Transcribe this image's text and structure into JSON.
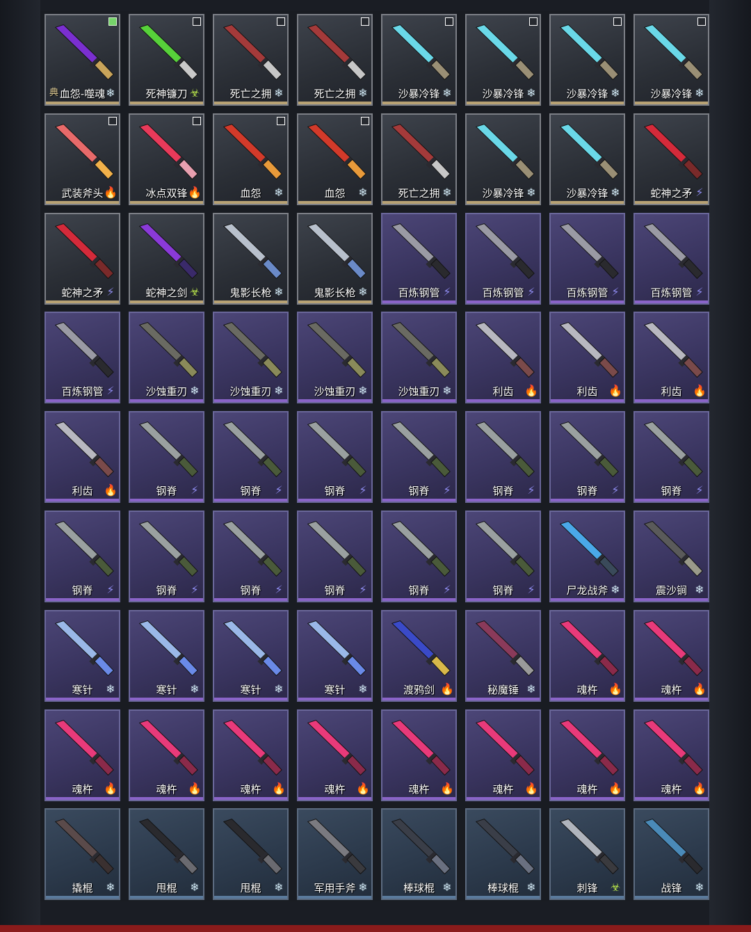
{
  "element_icons": {
    "snowflake": {
      "glyph": "❄",
      "color": "#cfe6f2"
    },
    "lightning": {
      "glyph": "⚡",
      "color": "#8f8cf0"
    },
    "fire": {
      "glyph": "🔥",
      "color": "#f0a53a"
    },
    "toxic": {
      "glyph": "☣",
      "color": "#b7e34a"
    }
  },
  "rarity_colors": {
    "gold": "#b8a274",
    "purple": "#8a64c8",
    "blue": "#5a7a9c"
  },
  "rows": [
    [
      {
        "name": "血怨-噬魂",
        "rarity": "gold",
        "element": "snowflake",
        "check": "on",
        "tag": "典",
        "icon": "purple-orb-amulet-icon",
        "c1": "#7a2fd0",
        "c2": "#c9a45a"
      },
      {
        "name": "死神镰刀",
        "rarity": "gold",
        "element": "toxic",
        "check": "off",
        "icon": "scythe-icon",
        "c1": "#57d13a",
        "c2": "#c9c9c9"
      },
      {
        "name": "死亡之拥",
        "rarity": "gold",
        "element": "snowflake",
        "check": "off",
        "icon": "rifle-icon",
        "c1": "#a43a3a",
        "c2": "#c7c7c7"
      },
      {
        "name": "死亡之拥",
        "rarity": "gold",
        "element": "snowflake",
        "check": "off",
        "icon": "rifle-icon",
        "c1": "#a43a3a",
        "c2": "#c7c7c7"
      },
      {
        "name": "沙暴冷锋",
        "rarity": "gold",
        "element": "snowflake",
        "check": "off",
        "icon": "ice-blade-icon",
        "c1": "#6ad8e8",
        "c2": "#9a8f75"
      },
      {
        "name": "沙暴冷锋",
        "rarity": "gold",
        "element": "snowflake",
        "check": "off",
        "icon": "ice-blade-icon",
        "c1": "#6ad8e8",
        "c2": "#9a8f75"
      },
      {
        "name": "沙暴冷锋",
        "rarity": "gold",
        "element": "snowflake",
        "check": "off",
        "icon": "ice-blade-icon",
        "c1": "#6ad8e8",
        "c2": "#9a8f75"
      },
      {
        "name": "沙暴冷锋",
        "rarity": "gold",
        "element": "snowflake",
        "check": "off",
        "icon": "ice-blade-icon",
        "c1": "#6ad8e8",
        "c2": "#9a8f75"
      }
    ],
    [
      {
        "name": "武装斧头",
        "rarity": "gold",
        "element": "fire",
        "check": "off",
        "icon": "battle-axe-icon",
        "c1": "#e86a6a",
        "c2": "#f2b14a"
      },
      {
        "name": "冰点双锋",
        "rarity": "gold",
        "element": "fire",
        "check": "off",
        "icon": "crossed-blades-icon",
        "c1": "#e83a5a",
        "c2": "#e8a0b0"
      },
      {
        "name": "血怨",
        "rarity": "gold",
        "element": "snowflake",
        "check": "off",
        "icon": "blood-staff-icon",
        "c1": "#d23a2a",
        "c2": "#e89a3a"
      },
      {
        "name": "血怨",
        "rarity": "gold",
        "element": "snowflake",
        "check": "off",
        "icon": "blood-staff-icon",
        "c1": "#d23a2a",
        "c2": "#e89a3a"
      },
      {
        "name": "死亡之拥",
        "rarity": "gold",
        "element": "snowflake",
        "check": "none",
        "icon": "rifle-icon",
        "c1": "#a43a3a",
        "c2": "#c7c7c7"
      },
      {
        "name": "沙暴冷锋",
        "rarity": "gold",
        "element": "snowflake",
        "check": "none",
        "icon": "ice-blade-icon",
        "c1": "#6ad8e8",
        "c2": "#9a8f75"
      },
      {
        "name": "沙暴冷锋",
        "rarity": "gold",
        "element": "snowflake",
        "check": "none",
        "icon": "ice-blade-icon",
        "c1": "#6ad8e8",
        "c2": "#9a8f75"
      },
      {
        "name": "蛇神之矛",
        "rarity": "gold",
        "element": "lightning",
        "check": "none",
        "icon": "serpent-spear-icon",
        "c1": "#d42a3a",
        "c2": "#7a2a2a"
      }
    ],
    [
      {
        "name": "蛇神之矛",
        "rarity": "gold",
        "element": "lightning",
        "check": "none",
        "icon": "serpent-spear-icon",
        "c1": "#d42a3a",
        "c2": "#7a2a2a"
      },
      {
        "name": "蛇神之剑",
        "rarity": "gold",
        "element": "toxic",
        "check": "none",
        "icon": "serpent-sword-icon",
        "c1": "#8a3ad8",
        "c2": "#3a2a6a"
      },
      {
        "name": "鬼影长枪",
        "rarity": "gold",
        "element": "snowflake",
        "check": "none",
        "icon": "phantom-lance-icon",
        "c1": "#b8c0cc",
        "c2": "#6a8ac8"
      },
      {
        "name": "鬼影长枪",
        "rarity": "gold",
        "element": "snowflake",
        "check": "none",
        "icon": "phantom-lance-icon",
        "c1": "#b8c0cc",
        "c2": "#6a8ac8"
      },
      {
        "name": "百炼钢管",
        "rarity": "purple",
        "element": "lightning",
        "check": "none",
        "icon": "steel-pipe-icon",
        "c1": "#9a9aa4",
        "c2": "#2a2a2e"
      },
      {
        "name": "百炼钢管",
        "rarity": "purple",
        "element": "lightning",
        "check": "none",
        "icon": "steel-pipe-icon",
        "c1": "#9a9aa4",
        "c2": "#2a2a2e"
      },
      {
        "name": "百炼钢管",
        "rarity": "purple",
        "element": "lightning",
        "check": "none",
        "icon": "steel-pipe-icon",
        "c1": "#9a9aa4",
        "c2": "#2a2a2e"
      },
      {
        "name": "百炼钢管",
        "rarity": "purple",
        "element": "lightning",
        "check": "none",
        "icon": "steel-pipe-icon",
        "c1": "#9a9aa4",
        "c2": "#2a2a2e"
      }
    ],
    [
      {
        "name": "百炼钢管",
        "rarity": "purple",
        "element": "lightning",
        "check": "none",
        "icon": "steel-pipe-icon",
        "c1": "#9a9aa4",
        "c2": "#2a2a2e"
      },
      {
        "name": "沙蚀重刃",
        "rarity": "purple",
        "element": "snowflake",
        "check": "none",
        "icon": "heavy-blade-icon",
        "c1": "#6a6a62",
        "c2": "#8a8a5a"
      },
      {
        "name": "沙蚀重刃",
        "rarity": "purple",
        "element": "snowflake",
        "check": "none",
        "icon": "heavy-blade-icon",
        "c1": "#6a6a62",
        "c2": "#8a8a5a"
      },
      {
        "name": "沙蚀重刃",
        "rarity": "purple",
        "element": "snowflake",
        "check": "none",
        "icon": "heavy-blade-icon",
        "c1": "#6a6a62",
        "c2": "#8a8a5a"
      },
      {
        "name": "沙蚀重刃",
        "rarity": "purple",
        "element": "snowflake",
        "check": "none",
        "icon": "heavy-blade-icon",
        "c1": "#6a6a62",
        "c2": "#8a8a5a"
      },
      {
        "name": "利齿",
        "rarity": "purple",
        "element": "fire",
        "check": "none",
        "icon": "knife-icon",
        "c1": "#b8b8c0",
        "c2": "#7a4a4a"
      },
      {
        "name": "利齿",
        "rarity": "purple",
        "element": "fire",
        "check": "none",
        "icon": "knife-icon",
        "c1": "#b8b8c0",
        "c2": "#7a4a4a"
      },
      {
        "name": "利齿",
        "rarity": "purple",
        "element": "fire",
        "check": "none",
        "icon": "knife-icon",
        "c1": "#b8b8c0",
        "c2": "#7a4a4a"
      }
    ],
    [
      {
        "name": "利齿",
        "rarity": "purple",
        "element": "fire",
        "check": "none",
        "icon": "knife-icon",
        "c1": "#b8b8c0",
        "c2": "#7a4a4a"
      },
      {
        "name": "钢脊",
        "rarity": "purple",
        "element": "lightning",
        "check": "none",
        "icon": "combat-knife-icon",
        "c1": "#9aa0a0",
        "c2": "#4a5a3a"
      },
      {
        "name": "钢脊",
        "rarity": "purple",
        "element": "lightning",
        "check": "none",
        "icon": "combat-knife-icon",
        "c1": "#9aa0a0",
        "c2": "#4a5a3a"
      },
      {
        "name": "钢脊",
        "rarity": "purple",
        "element": "lightning",
        "check": "none",
        "icon": "combat-knife-icon",
        "c1": "#9aa0a0",
        "c2": "#4a5a3a"
      },
      {
        "name": "钢脊",
        "rarity": "purple",
        "element": "lightning",
        "check": "none",
        "icon": "combat-knife-icon",
        "c1": "#9aa0a0",
        "c2": "#4a5a3a"
      },
      {
        "name": "钢脊",
        "rarity": "purple",
        "element": "lightning",
        "check": "none",
        "icon": "combat-knife-icon",
        "c1": "#9aa0a0",
        "c2": "#4a5a3a"
      },
      {
        "name": "钢脊",
        "rarity": "purple",
        "element": "lightning",
        "check": "none",
        "icon": "combat-knife-icon",
        "c1": "#9aa0a0",
        "c2": "#4a5a3a"
      },
      {
        "name": "钢脊",
        "rarity": "purple",
        "element": "lightning",
        "check": "none",
        "icon": "combat-knife-icon",
        "c1": "#9aa0a0",
        "c2": "#4a5a3a"
      }
    ],
    [
      {
        "name": "钢脊",
        "rarity": "purple",
        "element": "lightning",
        "check": "none",
        "icon": "combat-knife-icon",
        "c1": "#9aa0a0",
        "c2": "#4a5a3a"
      },
      {
        "name": "钢脊",
        "rarity": "purple",
        "element": "lightning",
        "check": "none",
        "icon": "combat-knife-icon",
        "c1": "#9aa0a0",
        "c2": "#4a5a3a"
      },
      {
        "name": "钢脊",
        "rarity": "purple",
        "element": "lightning",
        "check": "none",
        "icon": "combat-knife-icon",
        "c1": "#9aa0a0",
        "c2": "#4a5a3a"
      },
      {
        "name": "钢脊",
        "rarity": "purple",
        "element": "lightning",
        "check": "none",
        "icon": "combat-knife-icon",
        "c1": "#9aa0a0",
        "c2": "#4a5a3a"
      },
      {
        "name": "钢脊",
        "rarity": "purple",
        "element": "lightning",
        "check": "none",
        "icon": "combat-knife-icon",
        "c1": "#9aa0a0",
        "c2": "#4a5a3a"
      },
      {
        "name": "钢脊",
        "rarity": "purple",
        "element": "lightning",
        "check": "none",
        "icon": "combat-knife-icon",
        "c1": "#9aa0a0",
        "c2": "#4a5a3a"
      },
      {
        "name": "尸龙战斧",
        "rarity": "purple",
        "element": "snowflake",
        "check": "none",
        "icon": "dragon-axe-icon",
        "c1": "#4aa8e8",
        "c2": "#3a4a5a"
      },
      {
        "name": "震沙锏",
        "rarity": "purple",
        "element": "snowflake",
        "check": "none",
        "icon": "mace-rod-icon",
        "c1": "#5a5a5a",
        "c2": "#9a9a8a"
      }
    ],
    [
      {
        "name": "寒针",
        "rarity": "purple",
        "element": "snowflake",
        "check": "none",
        "icon": "rapier-icon",
        "c1": "#9ab8e8",
        "c2": "#6a8ae8"
      },
      {
        "name": "寒针",
        "rarity": "purple",
        "element": "snowflake",
        "check": "none",
        "icon": "rapier-icon",
        "c1": "#9ab8e8",
        "c2": "#6a8ae8"
      },
      {
        "name": "寒针",
        "rarity": "purple",
        "element": "snowflake",
        "check": "none",
        "icon": "rapier-icon",
        "c1": "#9ab8e8",
        "c2": "#6a8ae8"
      },
      {
        "name": "寒针",
        "rarity": "purple",
        "element": "snowflake",
        "check": "none",
        "icon": "rapier-icon",
        "c1": "#9ab8e8",
        "c2": "#6a8ae8"
      },
      {
        "name": "渡鸦剑",
        "rarity": "purple",
        "element": "fire",
        "check": "none",
        "icon": "raven-sword-icon",
        "c1": "#3a4ac8",
        "c2": "#d8b84a"
      },
      {
        "name": "秘魔锤",
        "rarity": "purple",
        "element": "snowflake",
        "check": "none",
        "icon": "spiked-mace-icon",
        "c1": "#8a3a5a",
        "c2": "#9a9a9a"
      },
      {
        "name": "魂杵",
        "rarity": "purple",
        "element": "fire",
        "check": "none",
        "icon": "soul-spear-icon",
        "c1": "#e83a7a",
        "c2": "#8a2a4a"
      },
      {
        "name": "魂杵",
        "rarity": "purple",
        "element": "fire",
        "check": "none",
        "icon": "soul-spear-icon",
        "c1": "#e83a7a",
        "c2": "#8a2a4a"
      }
    ],
    [
      {
        "name": "魂杵",
        "rarity": "purple",
        "element": "fire",
        "check": "none",
        "icon": "soul-spear-icon",
        "c1": "#e83a7a",
        "c2": "#8a2a4a"
      },
      {
        "name": "魂杵",
        "rarity": "purple",
        "element": "fire",
        "check": "none",
        "icon": "soul-spear-icon",
        "c1": "#e83a7a",
        "c2": "#8a2a4a"
      },
      {
        "name": "魂杵",
        "rarity": "purple",
        "element": "fire",
        "check": "none",
        "icon": "soul-spear-icon",
        "c1": "#e83a7a",
        "c2": "#8a2a4a"
      },
      {
        "name": "魂杵",
        "rarity": "purple",
        "element": "fire",
        "check": "none",
        "icon": "soul-spear-icon",
        "c1": "#e83a7a",
        "c2": "#8a2a4a"
      },
      {
        "name": "魂杵",
        "rarity": "purple",
        "element": "fire",
        "check": "none",
        "icon": "soul-spear-icon",
        "c1": "#e83a7a",
        "c2": "#8a2a4a"
      },
      {
        "name": "魂杵",
        "rarity": "purple",
        "element": "fire",
        "check": "none",
        "icon": "soul-spear-icon",
        "c1": "#e83a7a",
        "c2": "#8a2a4a"
      },
      {
        "name": "魂杵",
        "rarity": "purple",
        "element": "fire",
        "check": "none",
        "icon": "soul-spear-icon",
        "c1": "#e83a7a",
        "c2": "#8a2a4a"
      },
      {
        "name": "魂杵",
        "rarity": "purple",
        "element": "fire",
        "check": "none",
        "icon": "soul-spear-icon",
        "c1": "#e83a7a",
        "c2": "#8a2a4a"
      }
    ],
    [
      {
        "name": "撬棍",
        "rarity": "blue",
        "element": "snowflake",
        "check": "none",
        "icon": "crowbar-icon",
        "c1": "#5a4a4a",
        "c2": "#3a3030"
      },
      {
        "name": "甩棍",
        "rarity": "blue",
        "element": "snowflake",
        "check": "none",
        "icon": "baton-icon",
        "c1": "#2a2a2e",
        "c2": "#6a6a70"
      },
      {
        "name": "甩棍",
        "rarity": "blue",
        "element": "snowflake",
        "check": "none",
        "icon": "baton-icon",
        "c1": "#2a2a2e",
        "c2": "#6a6a70"
      },
      {
        "name": "军用手斧",
        "rarity": "blue",
        "element": "snowflake",
        "check": "none",
        "icon": "hatchet-icon",
        "c1": "#7a7a80",
        "c2": "#3a3a3e"
      },
      {
        "name": "棒球棍",
        "rarity": "blue",
        "element": "snowflake",
        "check": "none",
        "icon": "baseball-bat-icon",
        "c1": "#3a3e48",
        "c2": "#6a7080"
      },
      {
        "name": "棒球棍",
        "rarity": "blue",
        "element": "snowflake",
        "check": "none",
        "icon": "baseball-bat-icon",
        "c1": "#3a3e48",
        "c2": "#6a7080"
      },
      {
        "name": "刺锋",
        "rarity": "blue",
        "element": "toxic",
        "check": "none",
        "icon": "dagger-icon",
        "c1": "#b0b4bc",
        "c2": "#3a3a3e"
      },
      {
        "name": "战锋",
        "rarity": "blue",
        "element": "snowflake",
        "check": "none",
        "icon": "tactical-knife-icon",
        "c1": "#4a8ab8",
        "c2": "#2a2a2e"
      }
    ]
  ]
}
